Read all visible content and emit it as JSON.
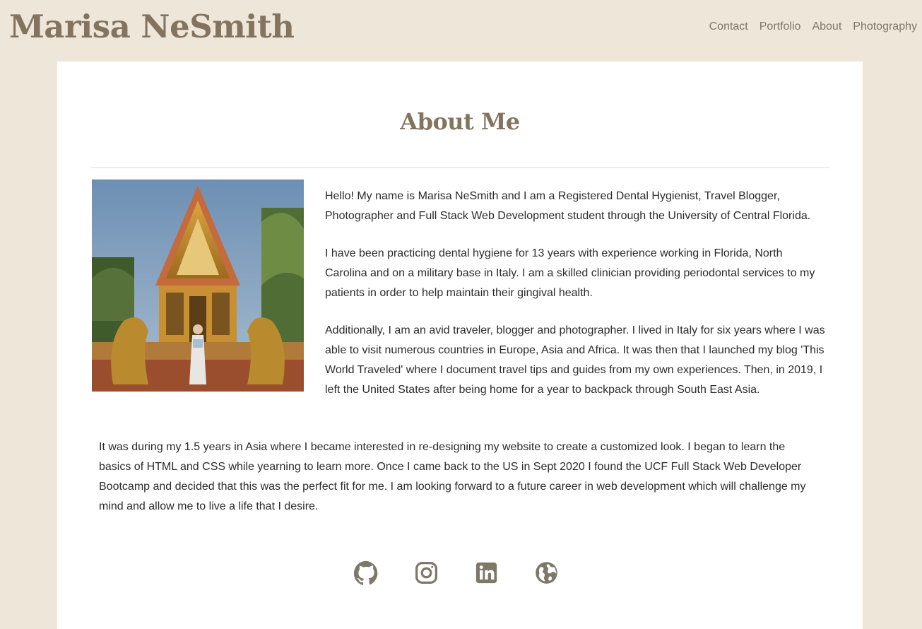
{
  "brand": "Marisa NeSmith",
  "nav": {
    "contact": "Contact",
    "portfolio": "Portfolio",
    "about": "About",
    "photography": "Photography"
  },
  "about": {
    "title": "About Me",
    "paragraphs": [
      "Hello! My name is Marisa NeSmith and I am a Registered Dental Hygienist, Travel Blogger, Photographer and Full Stack Web Development student through the University of Central Florida.",
      "I have been practicing dental hygiene for 13 years with experience working in Florida, North Carolina and on a military base in Italy. I am a skilled clinician providing periodontal services to my patients in order to help maintain their gingival health.",
      "Additionally, I am an avid traveler, blogger and photographer. I lived in Italy for six years where I was able to visit numerous countries in Europe, Asia and Africa. It was then that I launched my blog 'This World Traveled' where I document travel tips and guides from my own experiences. Then, in 2019, I left the United States after being home for a year to backpack through South East Asia.",
      "It was during my 1.5 years in Asia where I became interested in re-designing my website to create a customized look. I began to learn the basics of HTML and CSS while yearning to learn more. Once I came back to the US in Sept 2020 I found the UCF Full Stack Web Developer Bootcamp and decided that this was the perfect fit for me. I am looking forward to a future career in web development which will challenge my mind and allow me to live a life that I desire."
    ]
  },
  "socials": [
    {
      "icon": "github-icon"
    },
    {
      "icon": "instagram-icon"
    },
    {
      "icon": "linkedin-icon"
    },
    {
      "icon": "globe-icon"
    }
  ],
  "colors": {
    "page_background": "#efe6da",
    "accent": "#83745f",
    "nav_text": "#7d7868",
    "card": "#ffffff"
  }
}
